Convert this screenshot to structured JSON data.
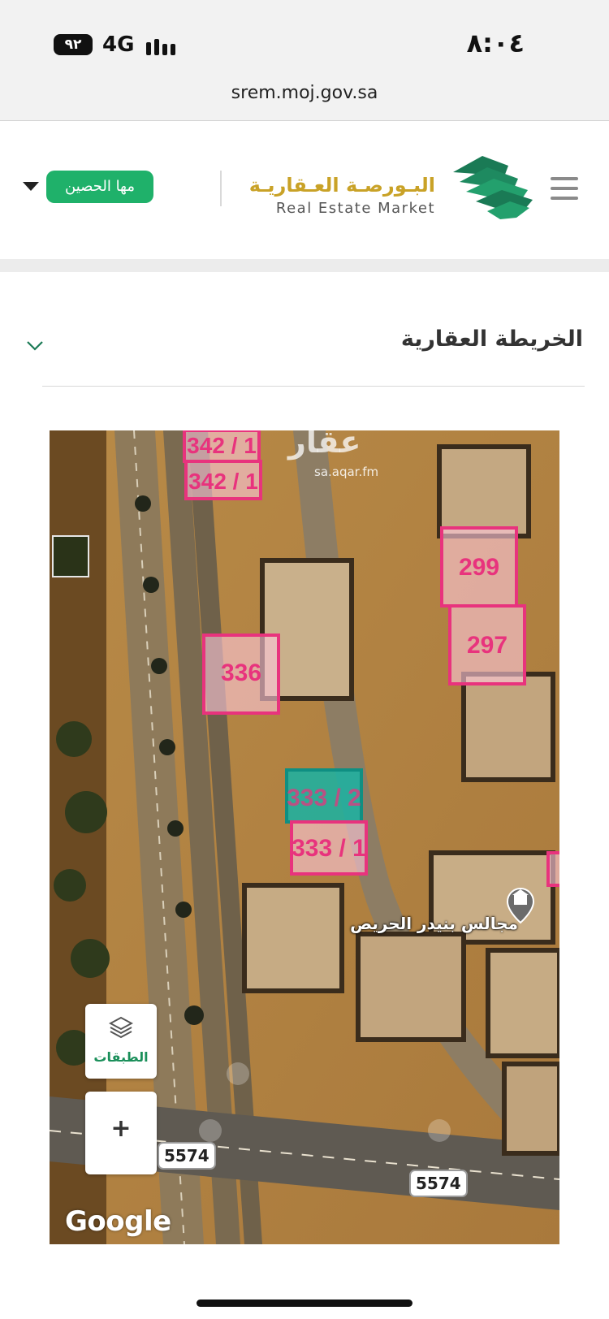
{
  "status_bar": {
    "battery": "٩٢",
    "network": "4G",
    "time": "٨:٠٤"
  },
  "browser": {
    "url": "srem.moj.gov.sa"
  },
  "header": {
    "logo_ar": "البـورصـة العـقاريـة",
    "logo_en": "Real Estate Market",
    "user_name": "مها الحصين"
  },
  "section": {
    "title": "الخريطة العقارية"
  },
  "map": {
    "watermark": "عقار",
    "watermark_sub": "sa.aqar.fm",
    "parcels": [
      {
        "label": "342 / 1"
      },
      {
        "label": "342 / 1"
      },
      {
        "label": "299"
      },
      {
        "label": "297"
      },
      {
        "label": "336"
      },
      {
        "label": "333 / 2"
      },
      {
        "label": "333 / 1"
      }
    ],
    "poi_label": "مجالس بنيدر الحريص",
    "road_labels": [
      "5574",
      "5574"
    ],
    "layers_label": "الطبقات",
    "zoom_in": "+",
    "attribution": "Google"
  },
  "colors": {
    "brand_green": "#1fb16a",
    "parcel_pink": "#e8337d",
    "selected_teal": "#19b3a3",
    "gold": "#c9a227"
  }
}
